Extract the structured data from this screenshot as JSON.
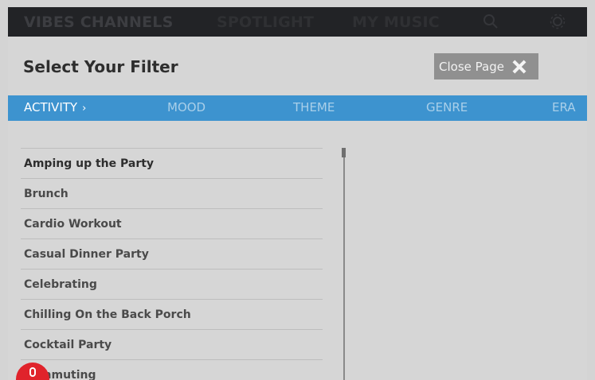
{
  "topnav": {
    "items": [
      {
        "label": "VIBES CHANNELS"
      },
      {
        "label": "SPOTLIGHT"
      },
      {
        "label": "MY MUSIC"
      }
    ],
    "icons": [
      "search-icon",
      "gear-icon"
    ]
  },
  "panel": {
    "title": "Select Your Filter",
    "close_label": "Close Page"
  },
  "tabs": [
    {
      "label": "ACTIVITY",
      "active": true,
      "chevron": "›"
    },
    {
      "label": "MOOD"
    },
    {
      "label": "THEME"
    },
    {
      "label": "GENRE"
    },
    {
      "label": "ERA"
    }
  ],
  "list": {
    "items": [
      {
        "label": "Amping up the Party"
      },
      {
        "label": "Brunch"
      },
      {
        "label": "Cardio Workout"
      },
      {
        "label": "Casual Dinner Party"
      },
      {
        "label": "Celebrating"
      },
      {
        "label": "Chilling On the Back Porch"
      },
      {
        "label": "Cocktail Party"
      },
      {
        "label": "Commuting"
      }
    ]
  },
  "colors": {
    "tab_bar": "#3d93cf",
    "close_button": "#909090",
    "badge": "#e0232b"
  }
}
